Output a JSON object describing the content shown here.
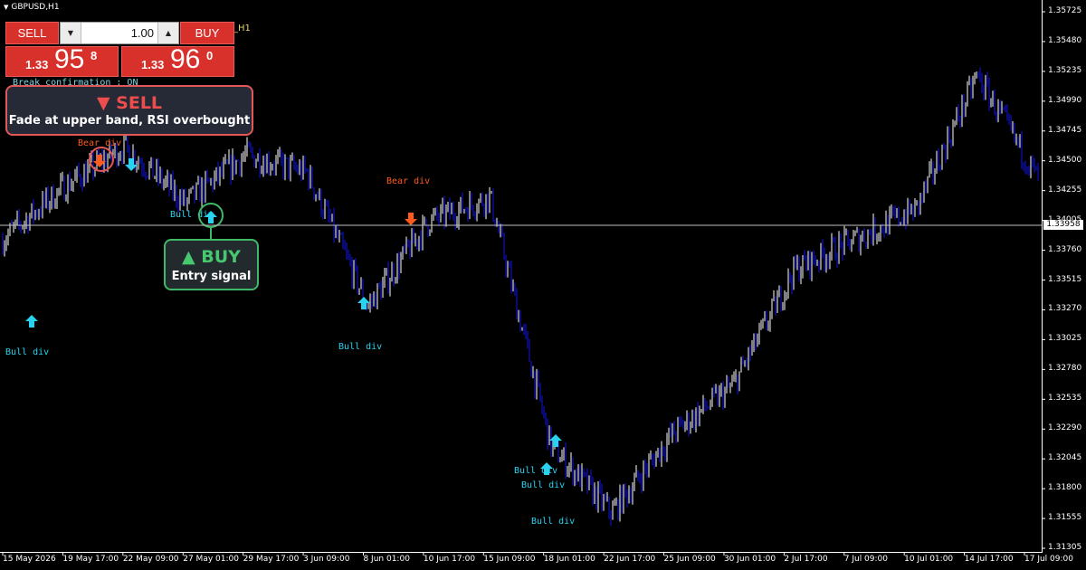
{
  "symbol_title": "GBPUSD,H1",
  "indicator_title": "_H1",
  "confirmation_text": "Break confirmation : ON",
  "trade_panel": {
    "sell_label": "SELL",
    "buy_label": "BUY",
    "volume": "1.00",
    "bid": {
      "small": "1.33",
      "big": "95",
      "sup": "8"
    },
    "ask": {
      "small": "1.33",
      "big": "96",
      "sup": "0"
    },
    "down_arrow": "▼",
    "up_arrow": "▲"
  },
  "callouts": {
    "sell": {
      "head": "▼ SELL",
      "sub": "Fade at upper band, RSI overbought"
    },
    "buy": {
      "head": "▲ BUY",
      "sub": "Entry signal"
    }
  },
  "price_axis": [
    "1.35725",
    "1.35480",
    "1.35235",
    "1.34990",
    "1.34745",
    "1.34500",
    "1.34255",
    "1.34005",
    "1.33760",
    "1.33515",
    "1.33270",
    "1.33025",
    "1.32780",
    "1.32535",
    "1.32290",
    "1.32045",
    "1.31800",
    "1.31555",
    "1.31305"
  ],
  "current_price": "1.33958",
  "time_axis": [
    "15 May 2026",
    "19 May 17:00",
    "22 May 09:00",
    "27 May 01:00",
    "29 May 17:00",
    "3 Jun 09:00",
    "8 Jun 01:00",
    "10 Jun 17:00",
    "15 Jun 09:00",
    "18 Jun 01:00",
    "22 Jun 17:00",
    "25 Jun 09:00",
    "30 Jun 01:00",
    "2 Jul 17:00",
    "7 Jul 09:00",
    "10 Jul 01:00",
    "14 Jul 17:00",
    "17 Jul 09:00"
  ],
  "divergence_labels": [
    {
      "text": "Bull div",
      "kind": "bull"
    },
    {
      "text": "Bear div",
      "kind": "bear"
    },
    {
      "text": "Bull div",
      "kind": "bull"
    },
    {
      "text": "Bull div",
      "kind": "bull"
    },
    {
      "text": "Bear div",
      "kind": "bear"
    },
    {
      "text": "Bull div",
      "kind": "bull"
    },
    {
      "text": "Bull div",
      "kind": "bull"
    },
    {
      "text": "Bull div",
      "kind": "bull"
    }
  ],
  "colors": {
    "background": "#000000",
    "bull_bar": "#ffffff",
    "bear_bar": "#1414e6",
    "bull_arrow": "#29d3f0",
    "bear_arrow": "#ff5a1e",
    "sell_button": "#d8312c"
  },
  "chart_data": {
    "type": "line",
    "title": "GBPUSD,H1",
    "xlabel": "",
    "ylabel": "",
    "ylim": [
      1.31305,
      1.35725
    ],
    "x": [
      "15 May 2026",
      "19 May 17:00",
      "22 May 09:00",
      "27 May 01:00",
      "29 May 17:00",
      "3 Jun 09:00",
      "8 Jun 01:00",
      "10 Jun 17:00",
      "15 Jun 09:00",
      "18 Jun 01:00",
      "22 Jun 17:00",
      "25 Jun 09:00",
      "30 Jun 01:00",
      "2 Jul 17:00",
      "7 Jul 09:00",
      "10 Jul 01:00",
      "14 Jul 17:00",
      "17 Jul 09:00"
    ],
    "series": [
      {
        "values": [
          1.3385,
          1.3428,
          1.3462,
          1.3415,
          1.3455,
          1.344,
          1.333,
          1.34,
          1.342,
          1.3215,
          1.316,
          1.3225,
          1.3265,
          1.336,
          1.3385,
          1.341,
          1.352,
          1.3435
        ]
      }
    ],
    "grid": false,
    "legend": "none"
  }
}
